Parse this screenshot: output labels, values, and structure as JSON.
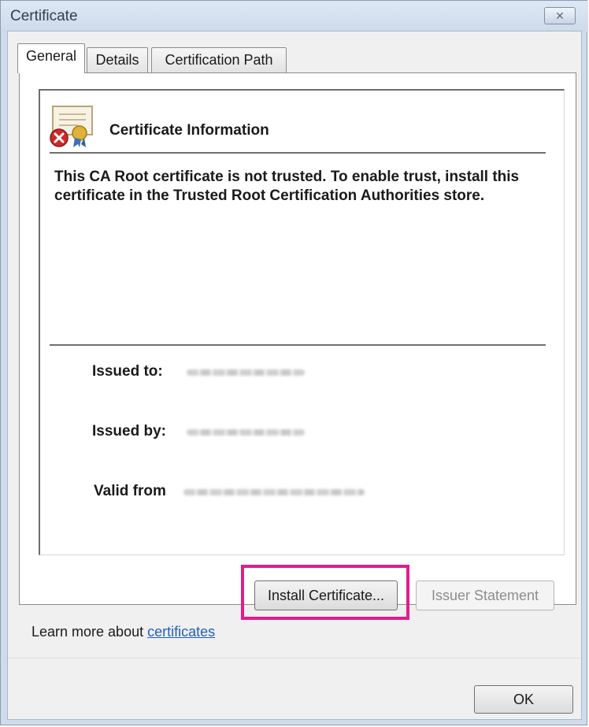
{
  "window": {
    "title": "Certificate",
    "close_glyph": "✕"
  },
  "tabs": [
    {
      "label": "General",
      "active": true
    },
    {
      "label": "Details",
      "active": false
    },
    {
      "label": "Certification Path",
      "active": false
    }
  ],
  "general": {
    "icon": "certificate-error-icon",
    "heading": "Certificate Information",
    "message": "This CA Root certificate is not trusted. To enable trust, install this certificate in the Trusted Root Certification Authorities store.",
    "issued_to_label": "Issued to:",
    "issued_by_label": "Issued by:",
    "valid_from_label": "Valid from"
  },
  "buttons": {
    "install_certificate": "Install Certificate...",
    "issuer_statement": "Issuer Statement",
    "ok": "OK"
  },
  "footer": {
    "learn_more_prefix": "Learn more about ",
    "learn_more_link": "certificates"
  },
  "colors": {
    "highlight": "#e01d8c",
    "link": "#1f5fbf"
  }
}
